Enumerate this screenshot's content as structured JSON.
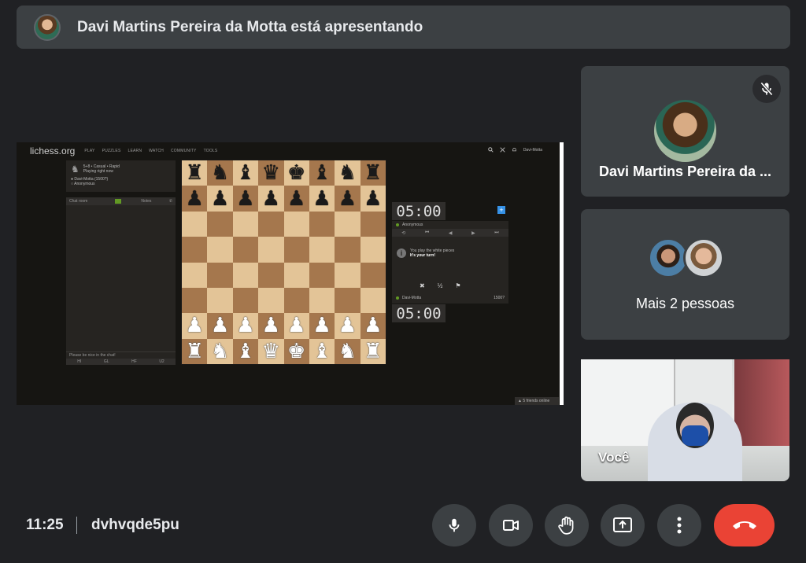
{
  "banner": {
    "text": "Davi Martins Pereira da Motta está apresentando",
    "avatar_icon": "presenter-avatar"
  },
  "lichess": {
    "logo": "lichess.org",
    "menu": [
      "PLAY",
      "PUZZLES",
      "LEARN",
      "WATCH",
      "COMMUNITY",
      "TOOLS"
    ],
    "username": "Davi-Motta",
    "game": {
      "mode": "5+8 • Casual • Rapid",
      "status": "Playing right now",
      "white": "Davi-Motta (1500?)",
      "black": "Anonymous"
    },
    "chat": {
      "tab_chat": "Chat room",
      "tab_notes": "Notes",
      "placeholder": "Please be nice in the chat!",
      "quick": [
        "HI",
        "GL",
        "HF",
        "U2"
      ]
    },
    "board": {
      "ranks": [
        [
          "♜",
          "♞",
          "♝",
          "♛",
          "♚",
          "♝",
          "♞",
          "♜"
        ],
        [
          "♟",
          "♟",
          "♟",
          "♟",
          "♟",
          "♟",
          "♟",
          "♟"
        ],
        [
          "",
          "",
          "",
          "",
          "",
          "",
          "",
          ""
        ],
        [
          "",
          "",
          "",
          "",
          "",
          "",
          "",
          ""
        ],
        [
          "",
          "",
          "",
          "",
          "",
          "",
          "",
          ""
        ],
        [
          "",
          "",
          "",
          "",
          "",
          "",
          "",
          ""
        ],
        [
          "♟",
          "♟",
          "♟",
          "♟",
          "♟",
          "♟",
          "♟",
          "♟"
        ],
        [
          "♜",
          "♞",
          "♝",
          "♛",
          "♚",
          "♝",
          "♞",
          "♜"
        ]
      ]
    },
    "clock_top": "05:00",
    "clock_bottom": "05:00",
    "opponent": "Anonymous",
    "player": "Davi-Motta",
    "player_rating": "1500?",
    "turn_msg_1": "You play the white pieces",
    "turn_msg_2": "It's your turn!",
    "draw_offer": "½",
    "friends": "▲ 5 friends online"
  },
  "tiles": {
    "presenter_name": "Davi Martins Pereira da ...",
    "others_label": "Mais 2 pessoas",
    "self_label": "Você"
  },
  "bottom": {
    "time": "11:25",
    "meeting_code": "dvhvqde5pu"
  },
  "colors": {
    "bg": "#202124",
    "surface": "#3c4043",
    "end_call": "#ea4335"
  }
}
